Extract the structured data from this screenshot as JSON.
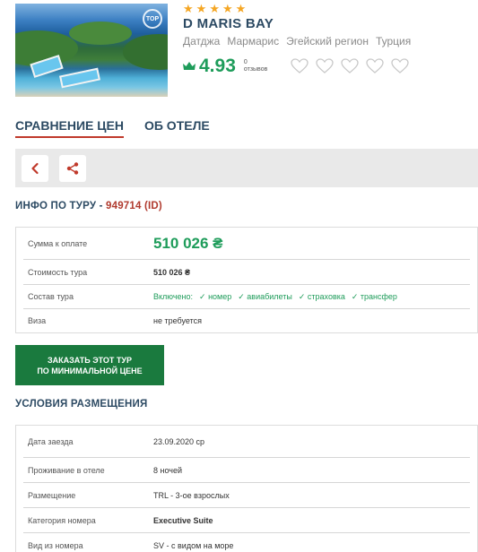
{
  "hotel": {
    "stars": 5,
    "name": "D MARIS BAY",
    "location": [
      "Датджа",
      "Мармарис",
      "Эгейский регион",
      "Турция"
    ],
    "photo_badge": "TOP",
    "rating": "4.93",
    "reviews_count": "0",
    "reviews_label": "отзывов",
    "hearts": 5
  },
  "tabs": [
    {
      "label": "СРАВНЕНИЕ ЦЕН",
      "active": true
    },
    {
      "label": "ОБ ОТЕЛЕ",
      "active": false
    }
  ],
  "toolbar": {
    "back_icon": "chevron-left-icon",
    "share_icon": "share-icon"
  },
  "tour_info": {
    "title_prefix": "ИНФО ПО ТУРУ -",
    "tour_id": "949714 (ID)",
    "rows": {
      "payment_label": "Сумма к оплате",
      "payment_value": "510 026 ₴",
      "cost_label": "Стоимость тура",
      "cost_value": "510 026 ₴",
      "composition_label": "Состав тура",
      "included_prefix": "Включено:",
      "included_items": [
        "номер",
        "авиабилеты",
        "страховка",
        "трансфер"
      ],
      "visa_label": "Виза",
      "visa_value": "не требуется"
    }
  },
  "order_button": {
    "line1": "ЗАКАЗАТЬ ЭТОТ ТУР",
    "line2": "ПО МИНИМАЛЬНОЙ ЦЕНЕ"
  },
  "accommodation": {
    "title": "УСЛОВИЯ РАЗМЕЩЕНИЯ",
    "rows": [
      {
        "label": "Дата заезда",
        "value": "23.09.2020 ср",
        "bold": false
      },
      {
        "label": "Проживание в отеле",
        "value": "8 ночей",
        "bold": false
      },
      {
        "label": "Размещение",
        "value": "TRL - 3-ое взрослых",
        "bold": false
      },
      {
        "label": "Категория номера",
        "value": "Executive Suite",
        "bold": true
      },
      {
        "label": "Вид из номера",
        "value": "SV - с видом на море",
        "bold": false
      }
    ]
  },
  "colors": {
    "green": "#1e9c5a",
    "button_green": "#1a7a3e",
    "red_accent": "#c0392b",
    "navy": "#2c4a63",
    "star": "#f5a623"
  }
}
